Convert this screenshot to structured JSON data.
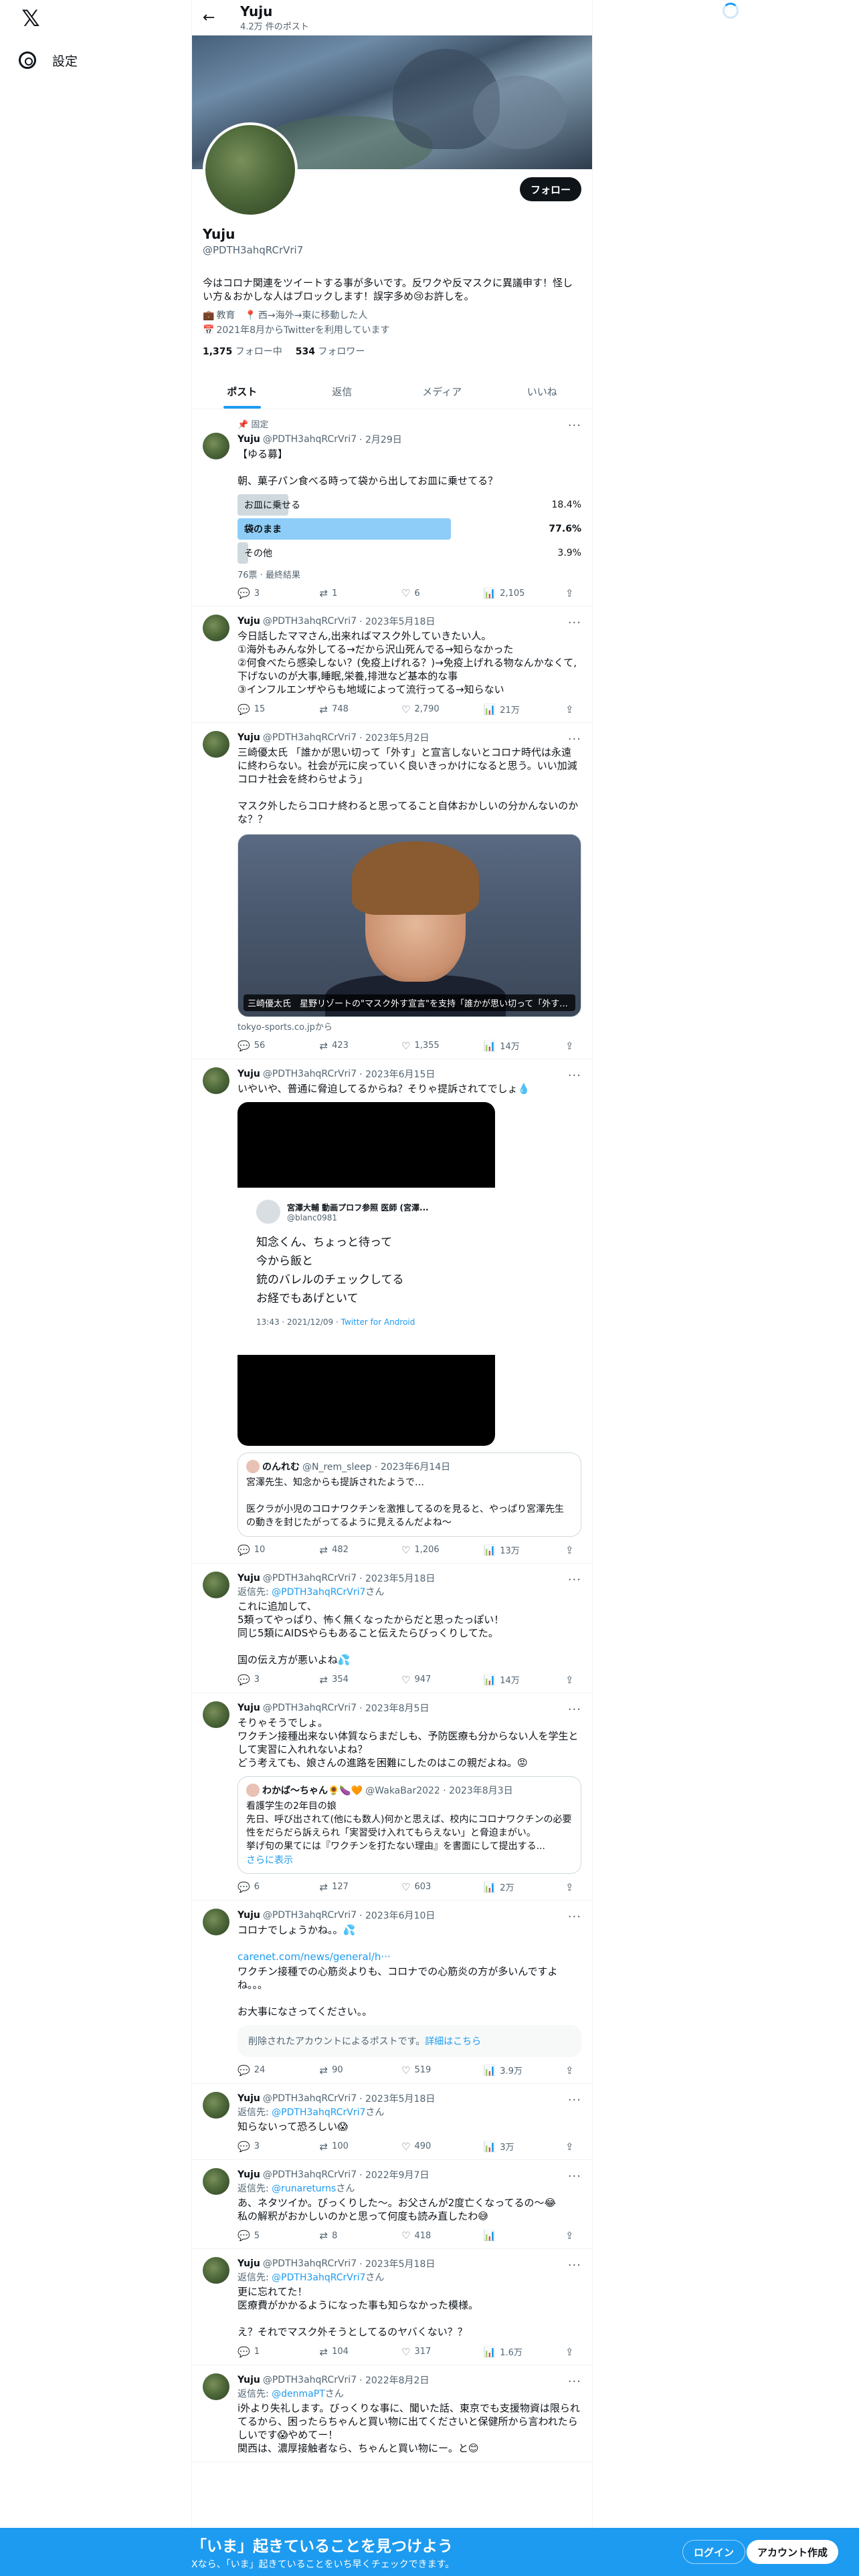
{
  "nav": {
    "logo": "𝕏",
    "settings_label": "設定"
  },
  "header": {
    "name": "Yuju",
    "post_count": "4.2万 件のポスト"
  },
  "profile": {
    "name": "Yuju",
    "handle": "@PDTH3ahqRCrVri7",
    "follow_label": "フォロー",
    "bio": "今はコロナ関連をツイートする事が多いです。反ワクや反マスクに異議申す！怪しい方＆おかしな人はブロックします！誤字多め😢お許しを。",
    "category": "教育",
    "location": "西→海外→東に移動した人",
    "joined": "2021年8月からTwitterを利用しています",
    "following_count": "1,375",
    "following_label": "フォロー中",
    "followers_count": "534",
    "followers_label": "フォロワー"
  },
  "tabs": [
    "ポスト",
    "返信",
    "メディア",
    "いいね"
  ],
  "tweets": [
    {
      "pinned": "固定",
      "name": "Yuju",
      "handle": "@PDTH3ahqRCrVri7",
      "date": "· 2月29日",
      "text": "【ゆる募】\n\n朝、菓子パン食べる時って袋から出してお皿に乗せてる？",
      "poll": [
        {
          "label": "お皿に乗せる",
          "pct": "18.4%",
          "value": 18.4,
          "win": false
        },
        {
          "label": "袋のまま",
          "pct": "77.6%",
          "value": 77.6,
          "win": true
        },
        {
          "label": "その他",
          "pct": "3.9%",
          "value": 3.9,
          "win": false
        }
      ],
      "poll_footer": "76票 · 最終結果",
      "reply": "3",
      "retweet": "1",
      "like": "6",
      "views": "2,105"
    },
    {
      "name": "Yuju",
      "handle": "@PDTH3ahqRCrVri7",
      "date": "· 2023年5月18日",
      "text": "今日話したママさん,出来ればマスク外していきたい人。\n①海外もみんな外してる→だから沢山死んでる→知らなかった\n②何食べたら感染しない？(免疫上げれる？)→免疫上げれる物なんかなくて,下げないのが大事,睡眠,栄養,排泄など基本的な事\n③インフルエンザやらも地域によって流行ってる→知らない",
      "reply": "15",
      "retweet": "748",
      "like": "2,790",
      "views": "21万"
    },
    {
      "name": "Yuju",
      "handle": "@PDTH3ahqRCrVri7",
      "date": "· 2023年5月2日",
      "text": "三崎優太氏 「誰かが思い切って「外す」と宣言しないとコロナ時代は永遠に終わらない。社会が元に戻っていく良いきっかけになると思う。いい加減コロナ社会を終わらせよう」\n\nマスク外したらコロナ終わると思ってること自体おかしいの分かんないのかな？？",
      "media_caption": "三崎優太氏　星野リゾートの\"マスク外す宣言\"を支持「誰かが思い切って「外す...",
      "media_source": "tokyo-sports.co.jpから",
      "reply": "56",
      "retweet": "423",
      "like": "1,355",
      "views": "14万"
    },
    {
      "name": "Yuju",
      "handle": "@PDTH3ahqRCrVri7",
      "date": "· 2023年6月15日",
      "text": "いやいや、普通に脅迫してるからね？そりゃ提訴されてでしょ💧",
      "inner": {
        "name": "宮澤大輔 動画プロフ参照 医師 (宮澤...",
        "handle": "@blanc0981",
        "text": "知念くん、ちょっと待って\n今から飯と\n銃のバレルのチェックしてる\nお経でもあげといて",
        "time": "13:43 · 2021/12/09 · ",
        "client": "Twitter for Android"
      },
      "quote": {
        "name": "のんれむ",
        "handle": "@N_rem_sleep · 2023年6月14日",
        "text": "宮澤先生、知念からも提訴されたようで…\n\n医クラが小児のコロナワクチンを激推してるのを見ると、やっぱり宮澤先生の動きを封じたがってるように見えるんだよね〜"
      },
      "reply": "10",
      "retweet": "482",
      "like": "1,206",
      "views": "13万"
    },
    {
      "name": "Yuju",
      "handle": "@PDTH3ahqRCrVri7",
      "date": "· 2023年5月18日",
      "reply_prefix": "返信先: ",
      "reply_to": "@PDTH3ahqRCrVri7",
      "reply_suffix": "さん",
      "text": "これに追加して、\n5類ってやっぱり、怖く無くなったからだと思ったっぽい！\n同じ5類にAIDSやらもあること伝えたらびっくりしてた。\n\n国の伝え方が悪いよね💦",
      "reply": "3",
      "retweet": "354",
      "like": "947",
      "views": "14万"
    },
    {
      "name": "Yuju",
      "handle": "@PDTH3ahqRCrVri7",
      "date": "· 2023年8月5日",
      "text": "そりゃそうでしょ。\nワクチン接種出来ない体質ならまだしも、予防医療も分からない人を学生として実習に入れれないよね？\nどう考えても、娘さんの進路を困難にしたのはこの親だよね。😡",
      "quote": {
        "name": "わかば〜ちゃん🌻🍆🧡",
        "handle": "@WakaBar2022 · 2023年8月3日",
        "text": "看護学生の2年目の娘\n先日、呼び出されて(他にも数人)何かと思えば、校内にコロナワクチンの必要性をだらだら訴えられ「実習受け入れてもらえない」と脅迫まがい。\n挙げ句の果てには『ワクチンを打たない理由』を書面にして提出する...",
        "more": "さらに表示"
      },
      "reply": "6",
      "retweet": "127",
      "like": "603",
      "views": "2万"
    },
    {
      "name": "Yuju",
      "handle": "@PDTH3ahqRCrVri7",
      "date": "· 2023年6月10日",
      "text": "コロナでしょうかね。。💦",
      "link": "carenet.com/news/general/h···",
      "text2": "ワクチン接種での心筋炎よりも、コロナでの心筋炎の方が多いんですよね。。。\n\nお大事になさってください。。",
      "deleted": "削除されたアカウントによるポストです。",
      "deleted_link": "詳細はこちら",
      "reply": "24",
      "retweet": "90",
      "like": "519",
      "views": "3.9万"
    },
    {
      "name": "Yuju",
      "handle": "@PDTH3ahqRCrVri7",
      "date": "· 2023年5月18日",
      "reply_prefix": "返信先: ",
      "reply_to": "@PDTH3ahqRCrVri7",
      "reply_suffix": "さん",
      "text": "知らないって恐ろしい😱",
      "reply": "3",
      "retweet": "100",
      "like": "490",
      "views": "3万"
    },
    {
      "name": "Yuju",
      "handle": "@PDTH3ahqRCrVri7",
      "date": "· 2022年9月7日",
      "reply_prefix": "返信先: ",
      "reply_to": "@runareturns",
      "reply_suffix": "さん",
      "text": "あ、ネタツイか。びっくりした〜。お父さんが2度亡くなってるの〜😂\n私の解釈がおかしいのかと思って何度も読み直したわ😅",
      "reply": "5",
      "retweet": "8",
      "like": "418",
      "views": ""
    },
    {
      "name": "Yuju",
      "handle": "@PDTH3ahqRCrVri7",
      "date": "· 2023年5月18日",
      "reply_prefix": "返信先: ",
      "reply_to": "@PDTH3ahqRCrVri7",
      "reply_suffix": "さん",
      "text": "更に忘れてた！\n医療費がかかるようになった事も知らなかった模様。\n\nえ？それでマスク外そうとしてるのヤバくない？？",
      "reply": "1",
      "retweet": "104",
      "like": "317",
      "views": "1.6万"
    },
    {
      "name": "Yuju",
      "handle": "@PDTH3ahqRCrVri7",
      "date": "· 2022年8月2日",
      "reply_prefix": "返信先: ",
      "reply_to": "@denmaPT",
      "reply_suffix": "さん",
      "text": "i外より失礼します。びっくりな事に、聞いた話、東京でも支援物資は限られてるから、困ったらちゃんと買い物に出てくださいと保健所から言われたらしいです😱やめてー！\n関西は、濃厚接触者なら、ちゃんと買い物にー。と😊",
      "reply": "",
      "retweet": "",
      "like": "",
      "views": ""
    }
  ],
  "bottom": {
    "title": "「いま」起きていることを見つけよう",
    "subtitle": "Xなら、「いま」起きていることをいち早くチェックできます。",
    "login": "ログイン",
    "signup": "アカウント作成"
  }
}
